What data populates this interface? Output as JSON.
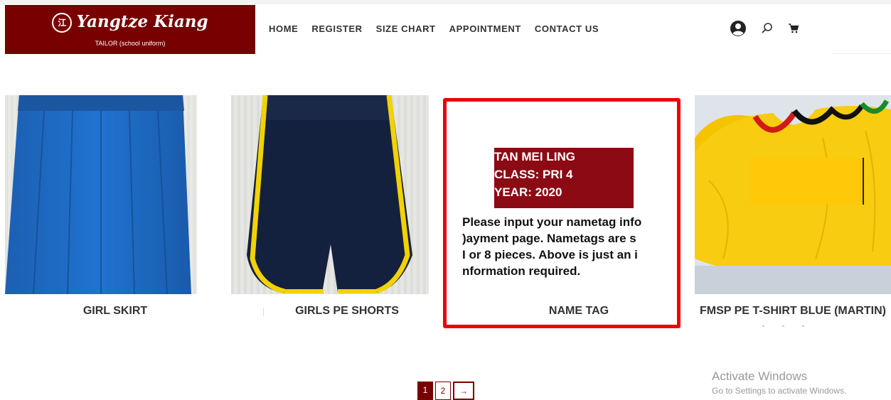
{
  "brand": {
    "logo_text": "Yangtze Kiang",
    "logo_seal": "江",
    "tagline": "TAILOR (school uniform)",
    "color": "#780000"
  },
  "nav": [
    "HOME",
    "REGISTER",
    "SIZE CHART",
    "APPOINTMENT",
    "CONTACT US"
  ],
  "header_icons": [
    "account-icon",
    "search-icon",
    "cart-icon"
  ],
  "products": [
    {
      "name": "GIRL SKIRT",
      "image": "blue pleated skirt"
    },
    {
      "name": "GIRLS PE SHORTS",
      "image": "navy shorts with yellow trim"
    },
    {
      "name": "NAME TAG",
      "tag_lines": [
        "TAN MEI LING",
        "CLASS: PRI 4",
        "YEAR: 2020"
      ],
      "info_lines": [
        "Please input your nametag info",
        ")ayment page.  Nametags are s",
        "I or 8 pieces. Above is just an i",
        "nformation required."
      ]
    },
    {
      "name": "FMSP PE T-SHIRT BLUE (MARTIN)",
      "image": "yellow PE t-shirts"
    }
  ],
  "highlight_color": "#ee0000",
  "pagination": {
    "pages": [
      "1",
      "2"
    ],
    "current": "1",
    "next": "→"
  },
  "watermark": {
    "title": "Activate Windows",
    "subtitle": "Go to Settings to activate Windows."
  }
}
